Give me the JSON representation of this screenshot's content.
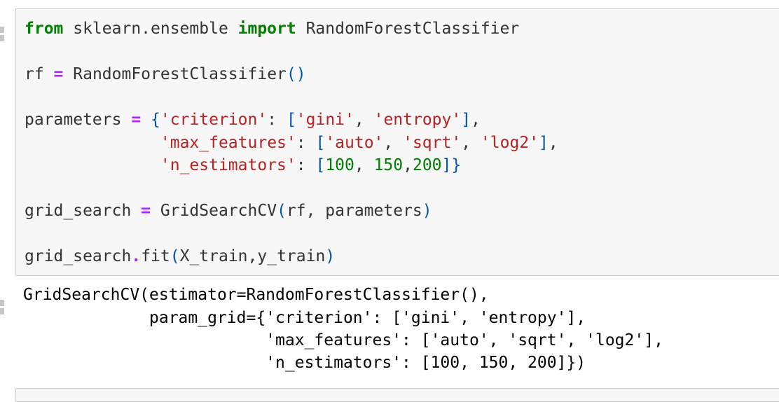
{
  "input_cell": {
    "line1": {
      "kw_from": "from",
      "module": " sklearn.ensemble ",
      "kw_import": "import",
      "name": " RandomForestClassifier"
    },
    "line2": {
      "lhs": "rf ",
      "eq": "=",
      "call": " RandomForestClassifier",
      "parens": "()"
    },
    "line3": {
      "lhs": "parameters ",
      "eq": "=",
      "sp": " ",
      "open": "{",
      "k_criterion": "'criterion'",
      "colon": ": ",
      "lb": "[",
      "v_gini": "'gini'",
      "comma": ", ",
      "v_entropy": "'entropy'",
      "rb": "]",
      "tail": ","
    },
    "line4": {
      "indent": "              ",
      "k_max_features": "'max_features'",
      "colon": ": ",
      "lb": "[",
      "v_auto": "'auto'",
      "comma1": ", ",
      "v_sqrt": "'sqrt'",
      "comma2": ", ",
      "v_log2": "'log2'",
      "rb": "]",
      "tail": ","
    },
    "line5": {
      "indent": "              ",
      "k_n_estimators": "'n_estimators'",
      "colon": ": ",
      "lb": "[",
      "n100": "100",
      "comma1": ", ",
      "n150": "150",
      "comma2": ",",
      "n200": "200",
      "rb": "]",
      "close": "}"
    },
    "line6": {
      "lhs": "grid_search ",
      "eq": "=",
      "call": " GridSearchCV",
      "open": "(",
      "args": "rf, parameters",
      "close": ")"
    },
    "line7": {
      "obj": "grid_search",
      "dot": ".",
      "method": "fit",
      "open": "(",
      "args": "X_train,y_train",
      "close": ")"
    }
  },
  "output_cell": {
    "lines": [
      "GridSearchCV(estimator=RandomForestClassifier(),",
      "             param_grid={'criterion': ['gini', 'entropy'],",
      "                         'max_features': ['auto', 'sqrt', 'log2'],",
      "                         'n_estimators': [100, 150, 200]})"
    ]
  }
}
